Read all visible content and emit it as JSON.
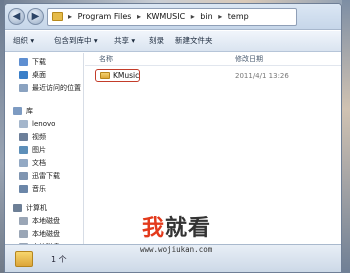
{
  "address_bar": {
    "crumbs": [
      "Program Files",
      "KWMUSIC",
      "bin",
      "temp"
    ],
    "separator": "▸"
  },
  "toolbar": {
    "organize": "组织 ▾",
    "include_in_library": "包含到库中 ▾",
    "share": "共享 ▾",
    "burn": "刻录",
    "new_folder": "新建文件夹"
  },
  "nav_pane": {
    "favorites": [
      "下载",
      "桌面",
      "最近访问的位置"
    ],
    "library_header": "库",
    "libraries": [
      "lenovo",
      "视频",
      "图片",
      "文档",
      "迅雷下载",
      "音乐"
    ],
    "computer_header": "计算机",
    "drives": [
      "本地磁盘",
      "本地磁盘",
      "本地磁盘"
    ]
  },
  "file_list": {
    "columns": {
      "name": "名称",
      "date": "修改日期"
    },
    "rows": [
      {
        "name": "KMusic",
        "date": "2011/4/1 13:26"
      }
    ]
  },
  "details": {
    "count": "1 个"
  },
  "watermark": {
    "brand_part1": "我",
    "brand_part2": "就看",
    "url": "www.wojiukan.com"
  },
  "colors": {
    "highlight_box": "#c33c2a",
    "brand_red": "#e33a1c",
    "toolbar_bg": "#dae4f0"
  },
  "icons": {
    "back": "back-arrow-icon",
    "forward": "forward-arrow-icon",
    "folder": "folder-icon"
  }
}
